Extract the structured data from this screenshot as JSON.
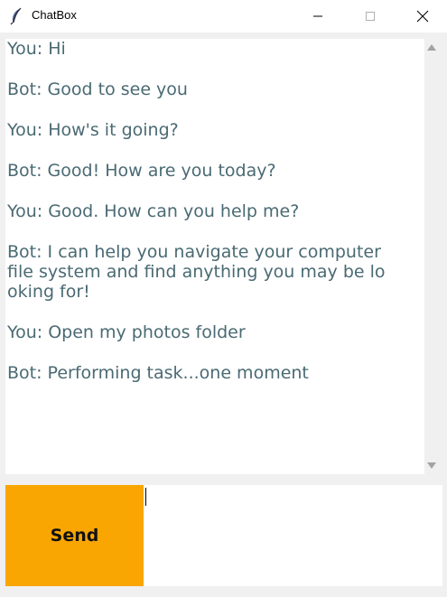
{
  "window": {
    "title": "ChatBox",
    "icon": "feather-icon",
    "controls": [
      "minimize-icon",
      "maximize-icon",
      "close-icon"
    ]
  },
  "chat": {
    "messages": [
      "You: Hi",
      "Bot: Good to see you",
      "You: How's it going?",
      "Bot: Good! How are you today?",
      "You: Good. How can you help me?",
      "Bot: I can help you navigate your computer\nfile system and find anything you may be lo\noking for!",
      "You: Open my photos folder",
      "Bot: Performing task...one moment"
    ],
    "text_color": "#4a6a73"
  },
  "input": {
    "send_label": "Send",
    "value": "",
    "send_color": "#f9a602"
  }
}
